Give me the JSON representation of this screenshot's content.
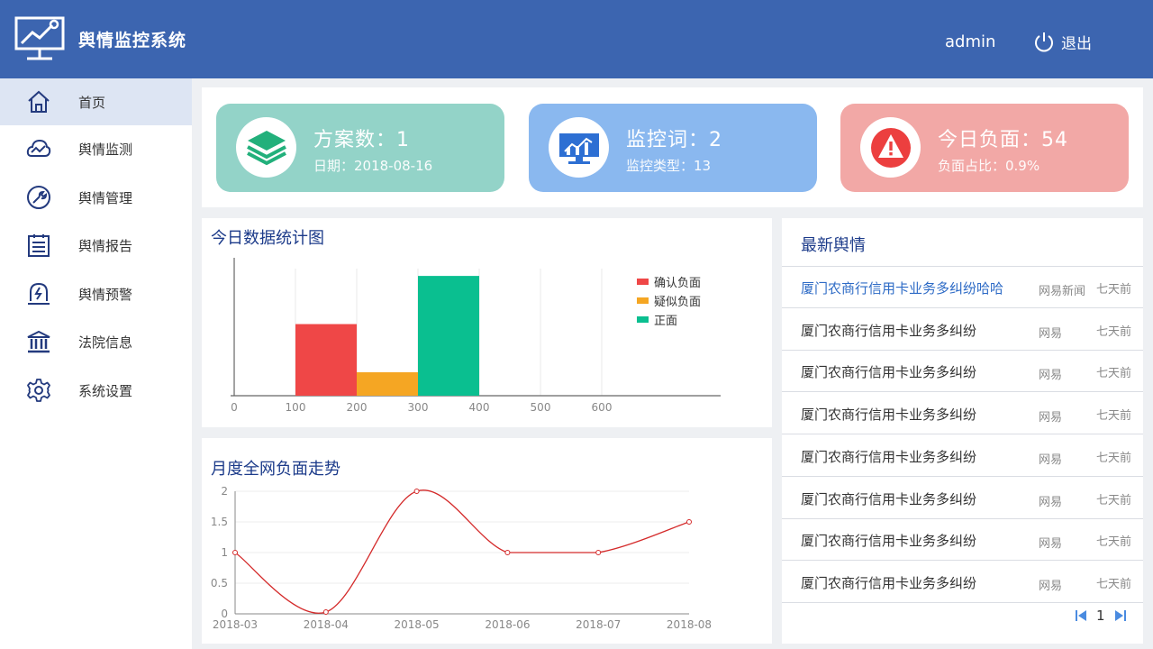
{
  "header": {
    "app_title": "舆情监控系统",
    "user": "admin",
    "logout_label": "退出",
    "background": "#3c65b0"
  },
  "sidebar": {
    "items": [
      {
        "label": "首页",
        "icon": "home-icon",
        "active": true
      },
      {
        "label": "舆情监测",
        "icon": "cloud-monitor-icon"
      },
      {
        "label": "舆情管理",
        "icon": "wrench-icon"
      },
      {
        "label": "舆情报告",
        "icon": "report-list-icon"
      },
      {
        "label": "舆情预警",
        "icon": "alert-lightning-icon"
      },
      {
        "label": "法院信息",
        "icon": "courthouse-icon"
      },
      {
        "label": "系统设置",
        "icon": "gear-icon"
      }
    ]
  },
  "stats": [
    {
      "title": "方案数：1",
      "sub": "日期：2018-08-16",
      "color": "#93d3c8",
      "icon": "layers-icon"
    },
    {
      "title": "监控词：2",
      "sub": "监控类型：13",
      "color": "#8ab8ef",
      "icon": "monitor-chart-icon"
    },
    {
      "title": "今日负面：54",
      "sub": "负面占比：0.9%",
      "color": "#f2a8a6",
      "icon": "warning-triangle-icon"
    }
  ],
  "bar_panel": {
    "title": "今日数据统计图"
  },
  "line_panel": {
    "title": "月度全网负面走势"
  },
  "news": {
    "title": "最新舆情",
    "items": [
      {
        "title": "厦门农商行信用卡业务多纠纷哈哈",
        "source": "网易新闻",
        "time": "七天前"
      },
      {
        "title": "厦门农商行信用卡业务多纠纷",
        "source": "网易",
        "time": "七天前"
      },
      {
        "title": "厦门农商行信用卡业务多纠纷",
        "source": "网易",
        "time": "七天前"
      },
      {
        "title": "厦门农商行信用卡业务多纠纷",
        "source": "网易",
        "time": "七天前"
      },
      {
        "title": "厦门农商行信用卡业务多纠纷",
        "source": "网易",
        "time": "七天前"
      },
      {
        "title": "厦门农商行信用卡业务多纠纷",
        "source": "网易",
        "time": "七天前"
      },
      {
        "title": "厦门农商行信用卡业务多纠纷",
        "source": "网易",
        "time": "七天前"
      },
      {
        "title": "厦门农商行信用卡业务多纠纷",
        "source": "网易",
        "time": "七天前"
      }
    ],
    "page": "1"
  },
  "chart_data": [
    {
      "type": "bar",
      "title": "今日数据统计图",
      "orientation": "vertical-bars-on-value-axis",
      "x_ticks": [
        "0",
        "100",
        "200",
        "300",
        "400",
        "500",
        "600"
      ],
      "xlim": [
        0,
        600
      ],
      "series": [
        {
          "name": "确认负面",
          "color": "#ef4747",
          "range": [
            100,
            200
          ],
          "value": 0.58
        },
        {
          "name": "疑似负面",
          "color": "#f5a623",
          "range": [
            200,
            300
          ],
          "value": 0.19
        },
        {
          "name": "正面",
          "color": "#0abf90",
          "range": [
            300,
            400
          ],
          "value": 0.97
        }
      ],
      "legend": "top-right",
      "grid": true
    },
    {
      "type": "line",
      "title": "月度全网负面走势",
      "categories": [
        "2018-03",
        "2018-04",
        "2018-05",
        "2018-06",
        "2018-07",
        "2018-08"
      ],
      "series": [
        {
          "values": [
            1,
            0.03,
            2,
            1,
            1,
            1.5
          ],
          "color": "#d42a2a"
        }
      ],
      "y_ticks": [
        "0",
        "0.5",
        "1",
        "1.5",
        "2"
      ],
      "ylim": [
        0,
        2
      ],
      "smooth": true,
      "grid": true
    }
  ]
}
